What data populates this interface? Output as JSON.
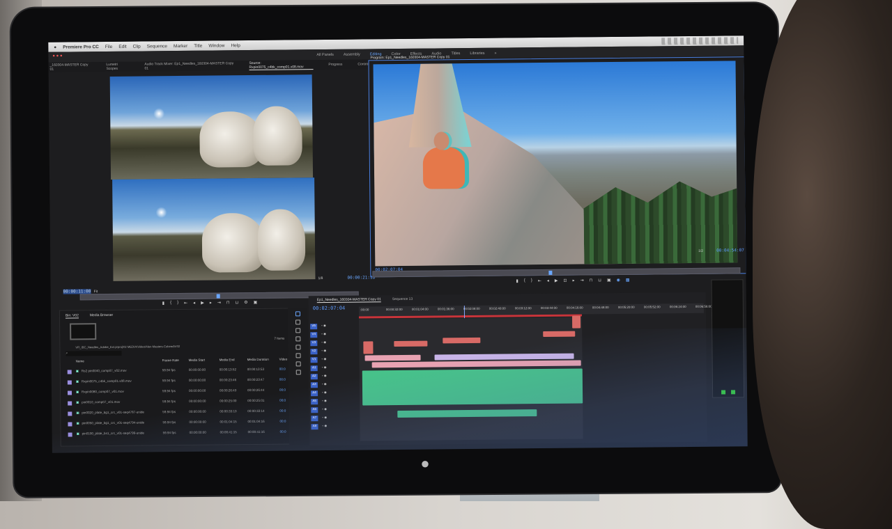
{
  "menu": {
    "apple": "",
    "app": "Premiere Pro CC",
    "items": [
      "File",
      "Edit",
      "Clip",
      "Sequence",
      "Marker",
      "Title",
      "Window",
      "Help"
    ]
  },
  "workspaces": {
    "items": [
      "All Panels",
      "Assembly",
      "Editing",
      "Color",
      "Effects",
      "Audio",
      "Titles",
      "Libraries"
    ],
    "active": "Editing",
    "more": "»"
  },
  "panel_tabs": [
    "_160304-MASTER Copy 01",
    "Lumetri Scopes",
    "Audio Track Mixer: Ep1_Needles_160304-MASTER Copy 01",
    "Source: Rxpin0075_c4bk_comp01.v08.mov",
    "Progress",
    "Control"
  ],
  "source": {
    "timecode": "00:00:11:00",
    "fit": "Fit",
    "zoom": "1/8",
    "duration": "00:00:21:18"
  },
  "program": {
    "title": "Program: Ep1_Needles_160304-MASTER Copy 01",
    "timecode": "00:02:07:04",
    "zoom": "1/2",
    "duration": "00:04:54:07"
  },
  "project": {
    "tabs": [
      "Bin: V02",
      "Media Browser"
    ],
    "items_count": "7 Items",
    "path": "VR_IBC_Needles_Adobe_Ext.prproj\\02 MEDIA\\Video\\Alex-Masters-Colored\\V02",
    "columns": [
      "Name",
      "Frame Rate",
      "Media Start",
      "Media End",
      "Media Duration",
      "Video I"
    ],
    "rows": [
      [
        "Ro2 pin0040_comp07_v02.mov",
        "59.94 fps",
        "00:00:00:00",
        "00:00:13:52",
        "00:00:13:53"
      ],
      [
        "Rxpin0075_c4bk_comp01.v08.mov",
        "59.94 fps",
        "00:00:00:00",
        "00:00:23:46",
        "00:00:23:47"
      ],
      [
        "Rxpin0080_comp07_v01.mov",
        "59.94 fps",
        "00:00:00:00",
        "00:00:26:43",
        "00:00:26:44"
      ],
      [
        "pin0010_comp07_v01.mov",
        "59.94 fps",
        "00:00:00:00",
        "00:00:25:00",
        "00:00:25:01"
      ],
      [
        "pin0020_plate_bg1_crc_v01-seq4787-unide",
        "59.94 fps",
        "00:00:00:00",
        "00:00:33:13",
        "00:00:33:14"
      ],
      [
        "pin0050_plate_bg1_crc_v01-seq4794-unide",
        "59.94 fps",
        "00:00:00:00",
        "00:01:04:15",
        "00:01:04:16"
      ],
      [
        "pin0100_plate_bs1_crc_v01-seq4799-unide",
        "59.94 fps",
        "00:00:00:00",
        "00:00:41:15",
        "00:00:41:16"
      ]
    ]
  },
  "timeline": {
    "tabs": [
      "Ep1_Needles_160304-MASTER Copy 01",
      "Sequence 13"
    ],
    "timecode": "00:02:07:04",
    "ruler": [
      ":00:00",
      "00:00:32:00",
      "00:01:04:00",
      "00:01:36:00",
      "00:02:08:00",
      "00:02:40:00",
      "00:03:12:00",
      "00:03:44:00",
      "00:04:16:00",
      "00:04:48:00",
      "00:05:20:00",
      "00:05:52:00",
      "00:06:24:00",
      "00:06:56:00"
    ],
    "tracks": [
      "V5",
      "V4",
      "V3",
      "V2",
      "V1",
      "A1",
      "A2",
      "A3",
      "A4",
      "A5",
      "A6",
      "A7",
      "A8"
    ]
  }
}
